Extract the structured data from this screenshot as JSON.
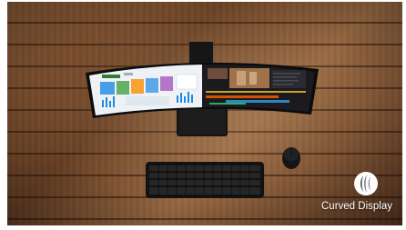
{
  "photo": {
    "caption": "Curved Display",
    "logo": "curved-display-logo-icon"
  }
}
